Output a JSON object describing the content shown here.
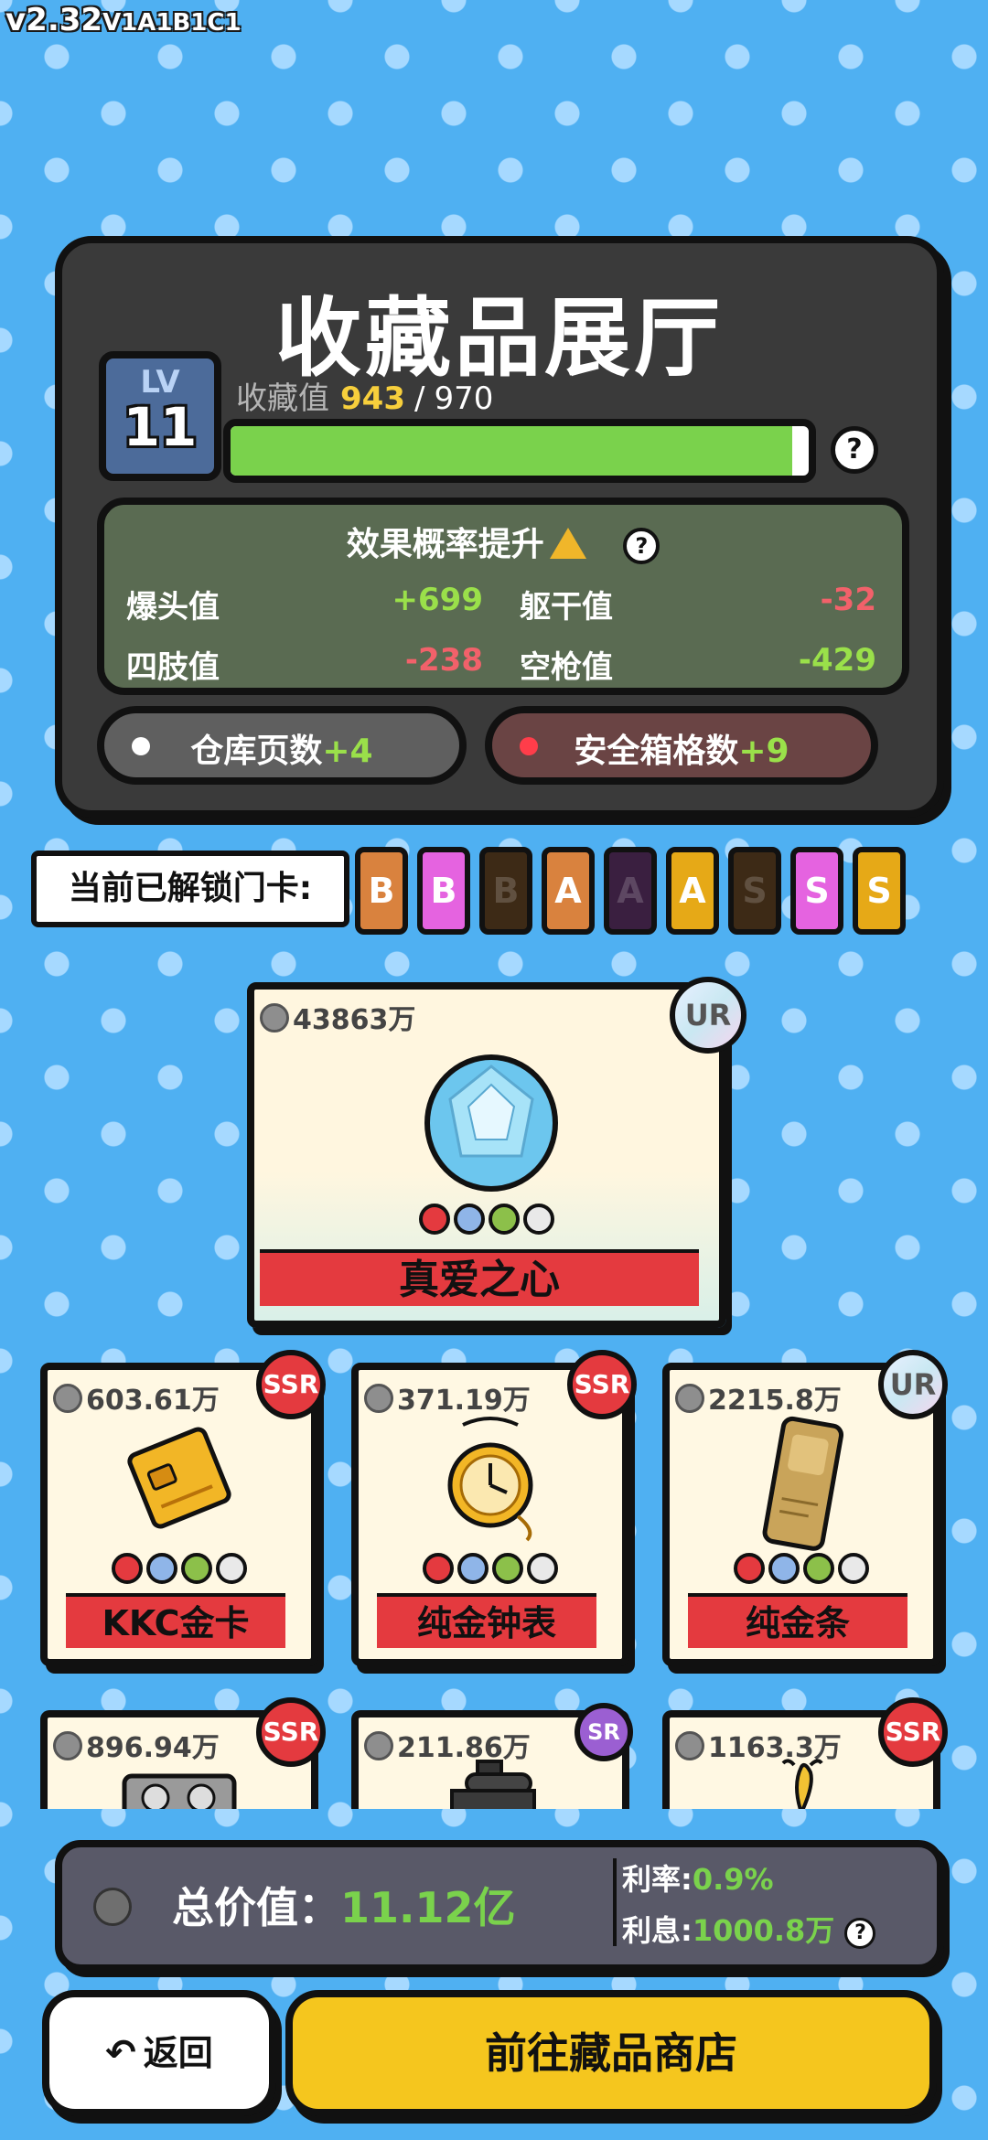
{
  "version": {
    "main": "v2.32",
    "sub": "V1A1B1C1"
  },
  "hall": {
    "title": "收藏品展厅",
    "level_label": "LV",
    "level": "11",
    "collection_label": "收藏值",
    "collection_current": "943",
    "collection_sep": "/",
    "collection_max": "970",
    "collection_progress": 0.972,
    "help": "?"
  },
  "effect": {
    "title": "效果概率提升",
    "help": "?",
    "stats": [
      {
        "name": "爆头值",
        "value": "+699",
        "positive": true
      },
      {
        "name": "躯干值",
        "value": "-32",
        "positive": false
      },
      {
        "name": "四肢值",
        "value": "-238",
        "positive": false
      },
      {
        "name": "空枪值",
        "value": "-429",
        "positive": true
      }
    ]
  },
  "bonuses": {
    "warehouse": {
      "label": "仓库页数",
      "value": "+4"
    },
    "safebox": {
      "label": "安全箱格数",
      "value": "+9"
    }
  },
  "unlock": {
    "label": "当前已解锁门卡:",
    "cards": [
      {
        "letter": "B",
        "color": "#d9823e",
        "dim": false
      },
      {
        "letter": "B",
        "color": "#e563e0",
        "dim": false
      },
      {
        "letter": "B",
        "color": "#3d2a16",
        "dim": true
      },
      {
        "letter": "A",
        "color": "#d9823e",
        "dim": false
      },
      {
        "letter": "A",
        "color": "#3a1f40",
        "dim": true
      },
      {
        "letter": "A",
        "color": "#e6a917",
        "dim": false
      },
      {
        "letter": "S",
        "color": "#3d2a16",
        "dim": true
      },
      {
        "letter": "S",
        "color": "#e563e0",
        "dim": false
      },
      {
        "letter": "S",
        "color": "#e6a917",
        "dim": false
      }
    ]
  },
  "featured": {
    "price": "43863万",
    "rarity": "UR",
    "name": "真爱之心"
  },
  "items": [
    {
      "price": "603.61万",
      "rarity": "SSR",
      "name": "KKC金卡"
    },
    {
      "price": "371.19万",
      "rarity": "SSR",
      "name": "纯金钟表"
    },
    {
      "price": "2215.8万",
      "rarity": "UR",
      "name": "纯金条"
    },
    {
      "price": "896.94万",
      "rarity": "SSR",
      "name": ""
    },
    {
      "price": "211.86万",
      "rarity": "SR",
      "name": ""
    },
    {
      "price": "1163.3万",
      "rarity": "SSR",
      "name": ""
    }
  ],
  "total": {
    "label": "总价值：",
    "value": "11.12亿",
    "rate_label": "利率:",
    "rate_value": "0.9%",
    "interest_label": "利息:",
    "interest_value": "1000.8万",
    "help": "?"
  },
  "buttons": {
    "back": "返回",
    "shop": "前往藏品商店"
  }
}
